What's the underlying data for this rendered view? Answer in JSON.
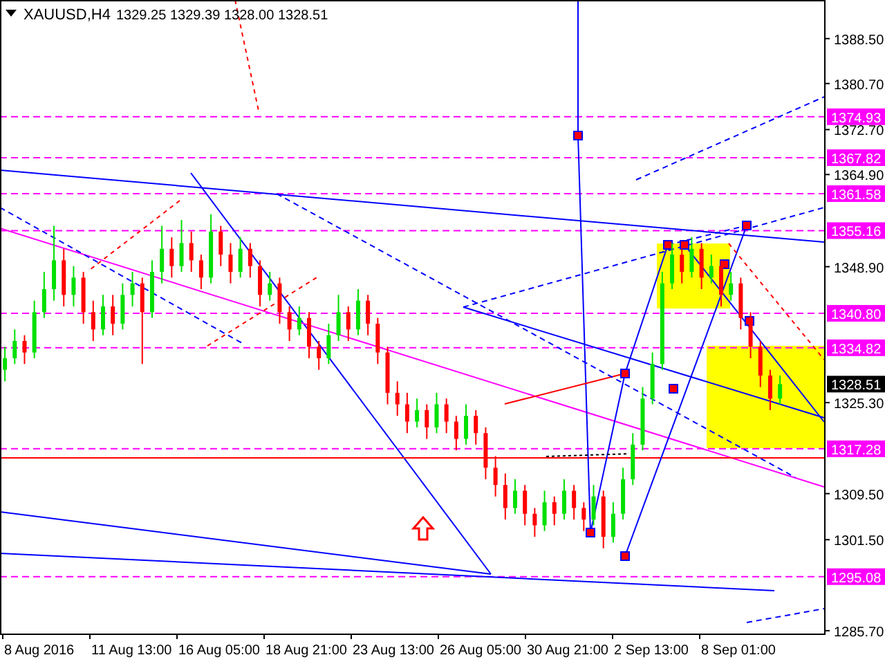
{
  "header": {
    "symbol": "XAUUSD,H4",
    "prices": [
      "1329.25",
      "1329.39",
      "1328.00",
      "1328.51"
    ]
  },
  "chart": {
    "chart_data": {
      "type": "candlestick",
      "categories": [
        null,
        null,
        null,
        null,
        null,
        null,
        null,
        null,
        null,
        null,
        null,
        null,
        null,
        null,
        null,
        null,
        null,
        null,
        null,
        null,
        null,
        null,
        null,
        null,
        null,
        null,
        null,
        null,
        null,
        null,
        null,
        null,
        null,
        null,
        null,
        null,
        null,
        null,
        null,
        null,
        null,
        null,
        null,
        null,
        null,
        null,
        null,
        null,
        null,
        null,
        null,
        null,
        null,
        null,
        null,
        null,
        null,
        null,
        null,
        null,
        null,
        null,
        null,
        null,
        null,
        null,
        null,
        null,
        null,
        null,
        null,
        null,
        null,
        null,
        null,
        null,
        null,
        null,
        null,
        null,
        null,
        null,
        null,
        null
      ],
      "ohlc": [
        [
          1331,
          1335,
          1329,
          1333
        ],
        [
          1333,
          1338,
          1332,
          1336
        ],
        [
          1336,
          1337,
          1332,
          1334
        ],
        [
          1334,
          1343,
          1333,
          1341
        ],
        [
          1341,
          1348,
          1340,
          1345
        ],
        [
          1345,
          1356,
          1343,
          1350
        ],
        [
          1350,
          1352,
          1342,
          1344
        ],
        [
          1344,
          1349,
          1342,
          1347
        ],
        [
          1347,
          1348,
          1339,
          1341
        ],
        [
          1341,
          1343,
          1336,
          1338
        ],
        [
          1338,
          1344,
          1337,
          1342
        ],
        [
          1342,
          1344,
          1337,
          1339
        ],
        [
          1339,
          1346,
          1338,
          1344
        ],
        [
          1344,
          1348,
          1342,
          1346
        ],
        [
          1346,
          1347,
          1332,
          1341
        ],
        [
          1341,
          1350,
          1340,
          1348
        ],
        [
          1348,
          1356,
          1346,
          1352
        ],
        [
          1352,
          1354,
          1347,
          1349
        ],
        [
          1349,
          1357,
          1348,
          1353
        ],
        [
          1353,
          1355,
          1348,
          1350
        ],
        [
          1350,
          1351,
          1345,
          1347
        ],
        [
          1347,
          1358,
          1346,
          1355
        ],
        [
          1355,
          1356,
          1349,
          1351
        ],
        [
          1351,
          1353,
          1346,
          1348
        ],
        [
          1348,
          1354,
          1347,
          1352
        ],
        [
          1352,
          1353,
          1347,
          1349
        ],
        [
          1349,
          1350,
          1342,
          1344
        ],
        [
          1344,
          1348,
          1343,
          1346
        ],
        [
          1346,
          1347,
          1339,
          1341
        ],
        [
          1341,
          1342,
          1336,
          1338
        ],
        [
          1338,
          1342,
          1337,
          1340
        ],
        [
          1340,
          1341,
          1333,
          1335
        ],
        [
          1335,
          1336,
          1331,
          1333
        ],
        [
          1333,
          1339,
          1332,
          1337
        ],
        [
          1337,
          1344,
          1336,
          1341
        ],
        [
          1341,
          1342,
          1336,
          1338
        ],
        [
          1338,
          1345,
          1337,
          1343
        ],
        [
          1343,
          1344,
          1337,
          1339
        ],
        [
          1339,
          1340,
          1332,
          1334
        ],
        [
          1334,
          1335,
          1325,
          1327
        ],
        [
          1327,
          1329,
          1323,
          1325
        ],
        [
          1325,
          1327,
          1320,
          1322
        ],
        [
          1322,
          1326,
          1321,
          1324
        ],
        [
          1324,
          1325,
          1319,
          1321
        ],
        [
          1321,
          1327,
          1320,
          1325
        ],
        [
          1325,
          1326,
          1320,
          1322
        ],
        [
          1322,
          1323,
          1317,
          1319
        ],
        [
          1319,
          1325,
          1318,
          1323
        ],
        [
          1323,
          1324,
          1318,
          1320
        ],
        [
          1320,
          1321,
          1312,
          1314
        ],
        [
          1314,
          1316,
          1309,
          1311
        ],
        [
          1311,
          1313,
          1305,
          1307
        ],
        [
          1307,
          1312,
          1306,
          1310
        ],
        [
          1310,
          1311,
          1304,
          1306
        ],
        [
          1306,
          1307,
          1302,
          1304
        ],
        [
          1304,
          1310,
          1303,
          1308
        ],
        [
          1308,
          1309,
          1304,
          1306
        ],
        [
          1306,
          1312,
          1305,
          1310
        ],
        [
          1310,
          1311,
          1305,
          1307
        ],
        [
          1307,
          1308,
          1303,
          1305
        ],
        [
          1305,
          1311,
          1304,
          1309
        ],
        [
          1309,
          1310,
          1300,
          1302
        ],
        [
          1302,
          1308,
          1301,
          1306
        ],
        [
          1306,
          1314,
          1305,
          1312
        ],
        [
          1312,
          1320,
          1311,
          1318
        ],
        [
          1318,
          1328,
          1317,
          1326
        ],
        [
          1326,
          1334,
          1325,
          1332
        ],
        [
          1332,
          1348,
          1331,
          1346
        ],
        [
          1346,
          1353,
          1345,
          1351
        ],
        [
          1351,
          1352,
          1346,
          1348
        ],
        [
          1348,
          1354,
          1347,
          1352
        ],
        [
          1352,
          1353,
          1345,
          1347
        ],
        [
          1347,
          1351,
          1346,
          1349
        ],
        [
          1349,
          1350,
          1342,
          1344
        ],
        [
          1344,
          1348,
          1343,
          1346
        ],
        [
          1346,
          1347,
          1338,
          1340
        ],
        [
          1340,
          1341,
          1333,
          1335
        ],
        [
          1335,
          1336,
          1328,
          1330
        ],
        [
          1330,
          1331,
          1324,
          1326
        ],
        [
          1326,
          1330,
          1325,
          1328.51
        ],
        null,
        null,
        null,
        null
      ],
      "ylim": [
        1285.2,
        1395.2
      ],
      "yticks": [
        {
          "value": 1388.5,
          "label": "1388.50"
        },
        {
          "value": 1380.7,
          "label": "1380.70"
        },
        {
          "value": 1372.7,
          "label": "1372.70"
        },
        {
          "value": 1364.9,
          "label": "1364.90"
        },
        {
          "value": 1348.9,
          "label": "1348.90"
        },
        {
          "value": 1325.3,
          "label": "1325.30"
        },
        {
          "value": 1309.5,
          "label": "1309.50"
        },
        {
          "value": 1301.5,
          "label": "1301.50"
        },
        {
          "value": 1285.7,
          "label": "1285.70"
        }
      ]
    }
  },
  "level_labels": [
    {
      "text": "1374.93",
      "color": "#ff00ff"
    },
    {
      "text": "1367.82",
      "color": "#ff00ff"
    },
    {
      "text": "1361.58",
      "color": "#ff00ff"
    },
    {
      "text": "1355.16",
      "color": "#ff00ff"
    },
    {
      "text": "1340.80",
      "color": "#ff00ff"
    },
    {
      "text": "1334.82",
      "color": "#ff00ff"
    },
    {
      "text": "1328.51",
      "color": "#000000"
    },
    {
      "text": "1317.28",
      "color": "#ff00ff"
    },
    {
      "text": "1295.08",
      "color": "#ff00ff"
    }
  ],
  "time_axis": {
    "labels": [
      "8 Aug 2016",
      "11 Aug 13:00",
      "16 Aug 05:00",
      "18 Aug 21:00",
      "23 Aug 13:00",
      "26 Aug 05:00",
      "30 Aug 21:00",
      "2 Sep 13:00",
      "8 Sep 01:00"
    ]
  }
}
